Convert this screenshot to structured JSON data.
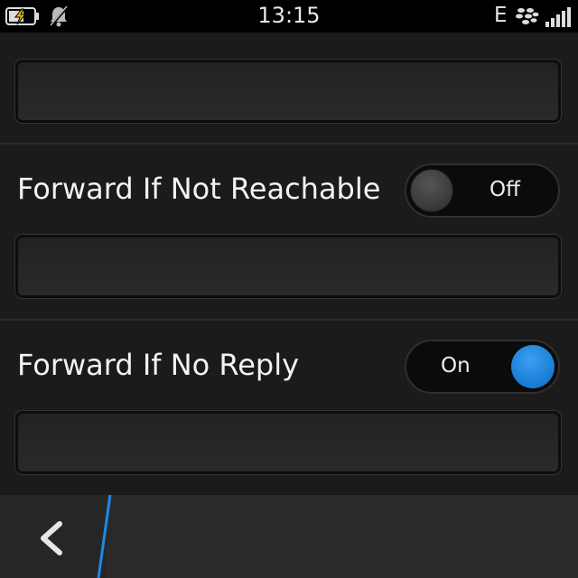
{
  "status_bar": {
    "time": "13:15",
    "network": "E",
    "battery_icon": "battery-charging-icon",
    "notification_icon": "bell-muted-icon",
    "messenger_icon": "blackberry-icon",
    "signal_icon": "signal-bars-icon"
  },
  "settings": [
    {
      "label": "",
      "field_value": ""
    },
    {
      "label": "Forward If Not Reachable",
      "toggle": "Off",
      "toggle_on": false,
      "field_value": ""
    },
    {
      "label": "Forward If No Reply",
      "toggle": "On",
      "toggle_on": true,
      "field_value": ""
    }
  ],
  "bottom_bar": {
    "back_icon": "chevron-left-icon"
  },
  "colors": {
    "accent": "#1e88e5",
    "toggle_on": "#1976d2",
    "background": "#1b1b1b"
  }
}
